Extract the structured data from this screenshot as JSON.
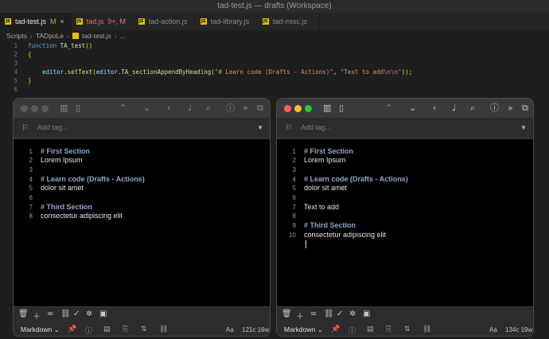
{
  "window_title": "tad-test.js — drafts (Workspace)",
  "tabs": [
    {
      "label": "tad-test.js",
      "badge": "M"
    },
    {
      "label": "tad.js",
      "badge": "9+, M"
    },
    {
      "label": "tad-action.js",
      "badge": ""
    },
    {
      "label": "tad-library.js",
      "badge": ""
    },
    {
      "label": "tad-misc.js",
      "badge": ""
    }
  ],
  "breadcrumb": [
    "Scripts",
    "TADpoLe",
    "tad-test.js",
    "..."
  ],
  "code_lines": [
    {
      "n": "1",
      "text": "function TA_test()"
    },
    {
      "n": "2",
      "text": "{"
    },
    {
      "n": "3",
      "text": ""
    },
    {
      "n": "4",
      "text": "    editor.setText(editor.TA_sectionAppendByHeading(\"# Learn code (Drafts - Actions)\", \"Text to add\\n\\n\"));"
    },
    {
      "n": "5",
      "text": "}"
    },
    {
      "n": "6",
      "text": ""
    }
  ],
  "drafts_left": {
    "tag_placeholder": "Add tag...",
    "lines": [
      {
        "n": "1",
        "text": "# First Section",
        "heading": true
      },
      {
        "n": "2",
        "text": "Lorem Ipsum",
        "heading": false
      },
      {
        "n": "3",
        "text": "",
        "heading": false
      },
      {
        "n": "4",
        "text": "# Learn code (Drafts - Actions)",
        "heading": true
      },
      {
        "n": "5",
        "text": "dolor sit amet",
        "heading": false
      },
      {
        "n": "6",
        "text": "",
        "heading": false
      },
      {
        "n": "7",
        "text": "# Third Section",
        "heading": true
      },
      {
        "n": "8",
        "text": "consectetur adipiscing elit",
        "heading": false
      }
    ],
    "mode": "Markdown",
    "font_size_label": "Aa",
    "count": "121c 16w"
  },
  "drafts_right": {
    "tag_placeholder": "Add tag...",
    "lines": [
      {
        "n": "1",
        "text": "# First Section",
        "heading": true
      },
      {
        "n": "2",
        "text": "Lorem Ipsum",
        "heading": false
      },
      {
        "n": "3",
        "text": "",
        "heading": false
      },
      {
        "n": "4",
        "text": "# Learn code (Drafts - Actions)",
        "heading": true
      },
      {
        "n": "5",
        "text": "dolor sit amet",
        "heading": false
      },
      {
        "n": "6",
        "text": "",
        "heading": false
      },
      {
        "n": "7",
        "text": "Text to add",
        "heading": false
      },
      {
        "n": "8",
        "text": "",
        "heading": false
      },
      {
        "n": "9",
        "text": "# Third Section",
        "heading": true
      },
      {
        "n": "10",
        "text": "consectetur adipiscing elit",
        "heading": false
      }
    ],
    "mode": "Markdown",
    "font_size_label": "Aa",
    "count": "134c 19w"
  },
  "colors": {
    "close": "#ff5f57",
    "minimize": "#febc2e",
    "zoom": "#28c840",
    "inactive_light": "#5a5a5c",
    "heading": "#8fa8c8"
  },
  "icons": [
    "sidebar-icon",
    "chevron-up-icon",
    "chevron-down-icon",
    "back-icon",
    "mic-icon",
    "search-icon",
    "info-icon",
    "actions-icon",
    "copy-icon",
    "flag-icon",
    "trash-icon",
    "plus-icon",
    "binoculars-icon",
    "link-icon",
    "check-icon",
    "gear-icon",
    "clipboard-icon",
    "pin-icon",
    "arrows-icon"
  ]
}
